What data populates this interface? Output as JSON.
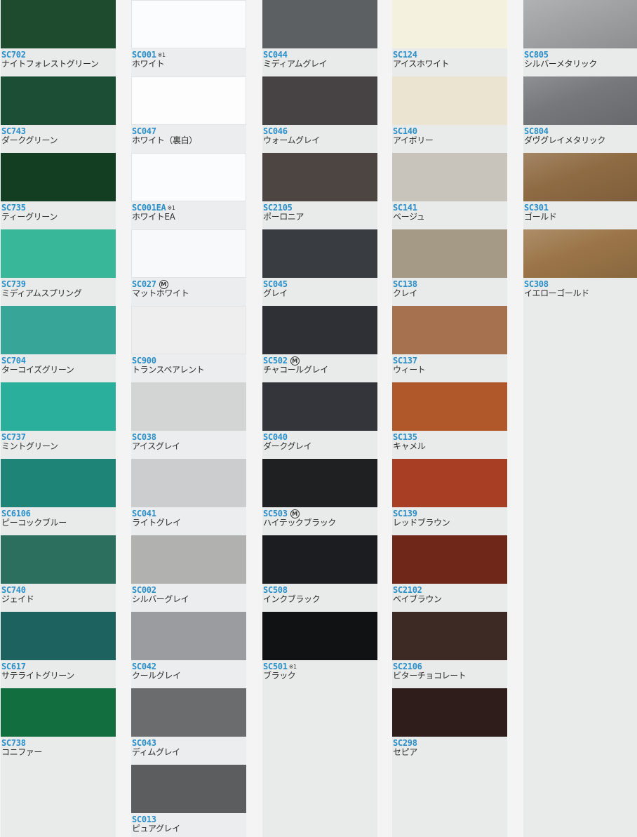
{
  "columns": [
    {
      "bg": "#e9eaea",
      "items": [
        {
          "code": "SC702",
          "name": "ナイトフォレストグリーン",
          "color": "#1e4a2e",
          "mark": ""
        },
        {
          "code": "SC743",
          "name": "ダークグリーン",
          "color": "#1c4d35",
          "mark": ""
        },
        {
          "code": "SC735",
          "name": "ティーグリーン",
          "color": "#133e22",
          "mark": ""
        },
        {
          "code": "SC739",
          "name": "ミディアムスプリング",
          "color": "#38b898",
          "mark": ""
        },
        {
          "code": "SC704",
          "name": "ターコイズグリーン",
          "color": "#37a597",
          "mark": ""
        },
        {
          "code": "SC737",
          "name": "ミントグリーン",
          "color": "#2aaf9c",
          "mark": ""
        },
        {
          "code": "SC6106",
          "name": "ピーコックブルー",
          "color": "#1d8477",
          "mark": ""
        },
        {
          "code": "SC740",
          "name": "ジェイド",
          "color": "#2c6f5f",
          "mark": ""
        },
        {
          "code": "SC617",
          "name": "サテライトグリーン",
          "color": "#1e6260",
          "mark": ""
        },
        {
          "code": "SC738",
          "name": "コニファー",
          "color": "#126e3f",
          "mark": ""
        }
      ]
    },
    {
      "bg": "#ecedee",
      "items": [
        {
          "code": "SC001",
          "name": "ホワイト",
          "color": "#fbfcfd",
          "mark": "※1"
        },
        {
          "code": "SC047",
          "name": "ホワイト（裏白）",
          "color": "#fdfdfe",
          "mark": ""
        },
        {
          "code": "SC001EA",
          "name": "ホワイトEA",
          "color": "#fbfcfd",
          "mark": "※1"
        },
        {
          "code": "SC027",
          "name": "マットホワイト",
          "color": "#f8f9fa",
          "mark": "M"
        },
        {
          "code": "SC900",
          "name": "トランスペアレント",
          "color": "#eeeeee",
          "mark": ""
        },
        {
          "code": "SC038",
          "name": "アイスグレイ",
          "color": "#d3d4d4",
          "mark": ""
        },
        {
          "code": "SC041",
          "name": "ライトグレイ",
          "color": "#cbcdcf",
          "mark": ""
        },
        {
          "code": "SC002",
          "name": "シルバーグレイ",
          "color": "#b1b1af",
          "mark": ""
        },
        {
          "code": "SC042",
          "name": "クールグレイ",
          "color": "#9a9c9f",
          "mark": ""
        },
        {
          "code": "SC043",
          "name": "ディムグレイ",
          "color": "#6b6c6e",
          "mark": ""
        },
        {
          "code": "SC013",
          "name": "ピュアグレイ",
          "color": "#5c5d5f",
          "mark": ""
        }
      ]
    },
    {
      "bg": "#e9eaea",
      "items": [
        {
          "code": "SC044",
          "name": "ミディアムグレイ",
          "color": "#5d6063",
          "mark": ""
        },
        {
          "code": "SC046",
          "name": "ウォームグレイ",
          "color": "#474345",
          "mark": ""
        },
        {
          "code": "SC2105",
          "name": "ポーロニア",
          "color": "#4c4542",
          "mark": ""
        },
        {
          "code": "SC045",
          "name": "グレイ",
          "color": "#393d42",
          "mark": ""
        },
        {
          "code": "SC502",
          "name": "チャコールグレイ",
          "color": "#2f3035",
          "mark": "M"
        },
        {
          "code": "SC040",
          "name": "ダークグレイ",
          "color": "#34353a",
          "mark": ""
        },
        {
          "code": "SC503",
          "name": "ハイテックブラック",
          "color": "#1f2022",
          "mark": "M"
        },
        {
          "code": "SC508",
          "name": "インクブラック",
          "color": "#1c1d20",
          "mark": ""
        },
        {
          "code": "SC501",
          "name": "ブラック",
          "color": "#111214",
          "mark": "※1"
        }
      ]
    },
    {
      "bg": "#e9eaea",
      "items": [
        {
          "code": "SC124",
          "name": "アイスホワイト",
          "color": "#f5f1df",
          "mark": ""
        },
        {
          "code": "SC140",
          "name": "アイボリー",
          "color": "#ebe4d1",
          "mark": ""
        },
        {
          "code": "SC141",
          "name": "ベージュ",
          "color": "#c8c4bc",
          "mark": ""
        },
        {
          "code": "SC138",
          "name": "クレイ",
          "color": "#a49a86",
          "mark": ""
        },
        {
          "code": "SC137",
          "name": "ウィート",
          "color": "#a5714f",
          "mark": ""
        },
        {
          "code": "SC135",
          "name": "キャメル",
          "color": "#b1582b",
          "mark": ""
        },
        {
          "code": "SC139",
          "name": "レッドブラウン",
          "color": "#a83f25",
          "mark": ""
        },
        {
          "code": "SC2102",
          "name": "ベイブラウン",
          "color": "#6e2718",
          "mark": ""
        },
        {
          "code": "SC2106",
          "name": "ビターチョコレート",
          "color": "#3d2a24",
          "mark": ""
        },
        {
          "code": "SC298",
          "name": "セピア",
          "color": "#2f1d1b",
          "mark": ""
        }
      ]
    },
    {
      "bg": "#e9eaea",
      "items": [
        {
          "code": "SC805",
          "name": "シルバーメタリック",
          "color": "#9fa1a3",
          "mark": ""
        },
        {
          "code": "SC804",
          "name": "ダヴグレイメタリック",
          "color": "#76777a",
          "mark": ""
        },
        {
          "code": "SC301",
          "name": "ゴールド",
          "color": "#8f6b43",
          "mark": ""
        },
        {
          "code": "SC308",
          "name": "イエローゴールド",
          "color": "#9b7548",
          "mark": ""
        }
      ]
    }
  ]
}
